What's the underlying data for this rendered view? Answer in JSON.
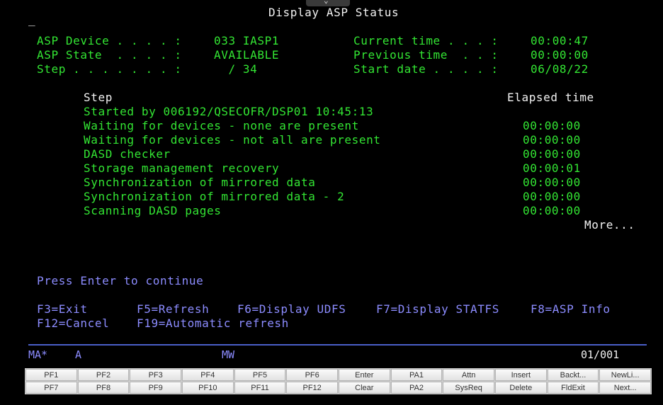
{
  "screen": {
    "cursor": "_",
    "title": "Display ASP Status",
    "fields_left": [
      {
        "label": "ASP Device . . . . :",
        "value": "033 IASP1"
      },
      {
        "label": "ASP State  . . . . :",
        "value": "AVAILABLE"
      },
      {
        "label": "Step . . . . . . . :",
        "value": "  / 34"
      }
    ],
    "fields_right": [
      {
        "label": "Current time . . . :",
        "value": "00:00:47"
      },
      {
        "label": "Previous time  . . :",
        "value": "00:00:00"
      },
      {
        "label": "Start date . . . . :",
        "value": "06/08/22"
      }
    ],
    "table": {
      "header_step": "Step",
      "header_elapsed": "Elapsed time",
      "started_by": "Started by 006192/QSECOFR/DSP01 10:45:13",
      "rows": [
        {
          "step": "Waiting for devices - none are present",
          "elapsed": "00:00:00"
        },
        {
          "step": "Waiting for devices - not all are present",
          "elapsed": "00:00:00"
        },
        {
          "step": "DASD checker",
          "elapsed": "00:00:00"
        },
        {
          "step": "Storage management recovery",
          "elapsed": "00:00:01"
        },
        {
          "step": "Synchronization of mirrored data",
          "elapsed": "00:00:00"
        },
        {
          "step": "Synchronization of mirrored data - 2",
          "elapsed": "00:00:00"
        },
        {
          "step": "Scanning DASD pages",
          "elapsed": "00:00:00"
        }
      ],
      "more": "More..."
    },
    "prompt": "Press Enter to continue",
    "fkeys_row1": [
      "F3=Exit",
      "F5=Refresh",
      "F6=Display UDFS",
      "F7=Display STATFS",
      "F8=ASP Info"
    ],
    "fkeys_row2": [
      "F12=Cancel",
      "F19=Automatic refresh"
    ]
  },
  "status_bar": {
    "ma": "MA*",
    "a": "A",
    "mw": "MW",
    "position": "01/001"
  },
  "keypad": {
    "row1": [
      "PF1",
      "PF2",
      "PF3",
      "PF4",
      "PF5",
      "PF6",
      "Enter",
      "PA1",
      "Attn",
      "Insert",
      "Backt...",
      "NewLi..."
    ],
    "row2": [
      "PF7",
      "PF8",
      "PF9",
      "PF10",
      "PF11",
      "PF12",
      "Clear",
      "PA2",
      "SysReq",
      "Delete",
      "FldExit",
      "Next..."
    ]
  },
  "colors": {
    "green": "#33e633",
    "white": "#f2f2f2",
    "blue": "#8c8cff",
    "background": "#000000",
    "separator": "#4a5ec8"
  }
}
